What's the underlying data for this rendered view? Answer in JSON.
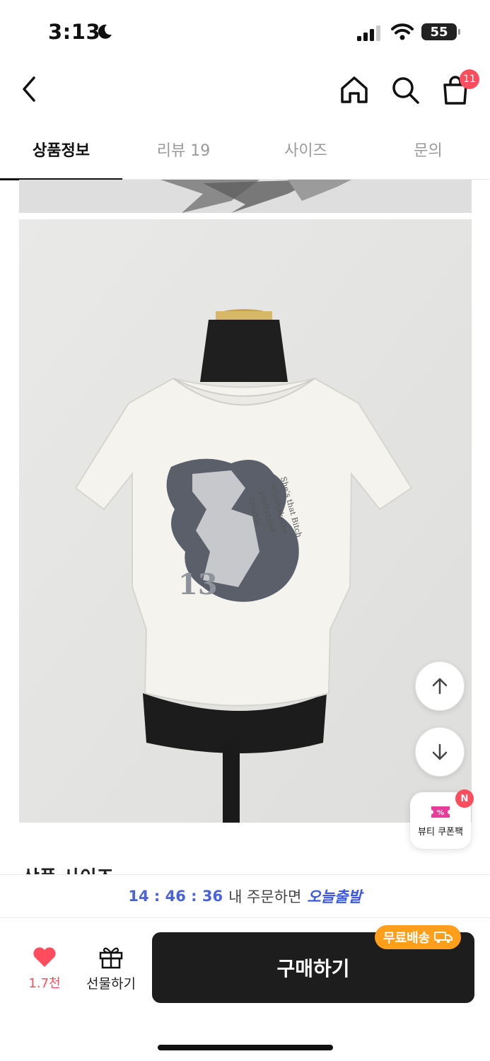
{
  "status_bar": {
    "time": "3:13",
    "battery": "55"
  },
  "nav": {
    "cart_count": "11",
    "icons": [
      "back-chevron-icon",
      "home-icon",
      "search-icon",
      "shopping-bag-icon"
    ]
  },
  "tabs": [
    {
      "label": "상품정보",
      "active": true
    },
    {
      "label": "리뷰 19",
      "active": false
    },
    {
      "label": "사이즈",
      "active": false
    },
    {
      "label": "문의",
      "active": false
    }
  ],
  "content": {
    "section_peek_title": "상품 사이즈"
  },
  "floating": {
    "coupon_label": "뷰티 쿠폰팩",
    "coupon_badge": "N"
  },
  "banner": {
    "timer": "14 : 46 : 36",
    "middle": "내 주문하면",
    "highlight": "오늘출발"
  },
  "buy_bar": {
    "wish_count": "1.7천",
    "gift_label": "선물하기",
    "buy_label": "구매하기",
    "free_shipping": "무료배송"
  },
  "colors": {
    "accent_red": "#ff4d5e",
    "accent_blue": "#3a57e8",
    "free_ship_orange": "#ff9e1b",
    "buy_button": "#1d1d1d"
  }
}
